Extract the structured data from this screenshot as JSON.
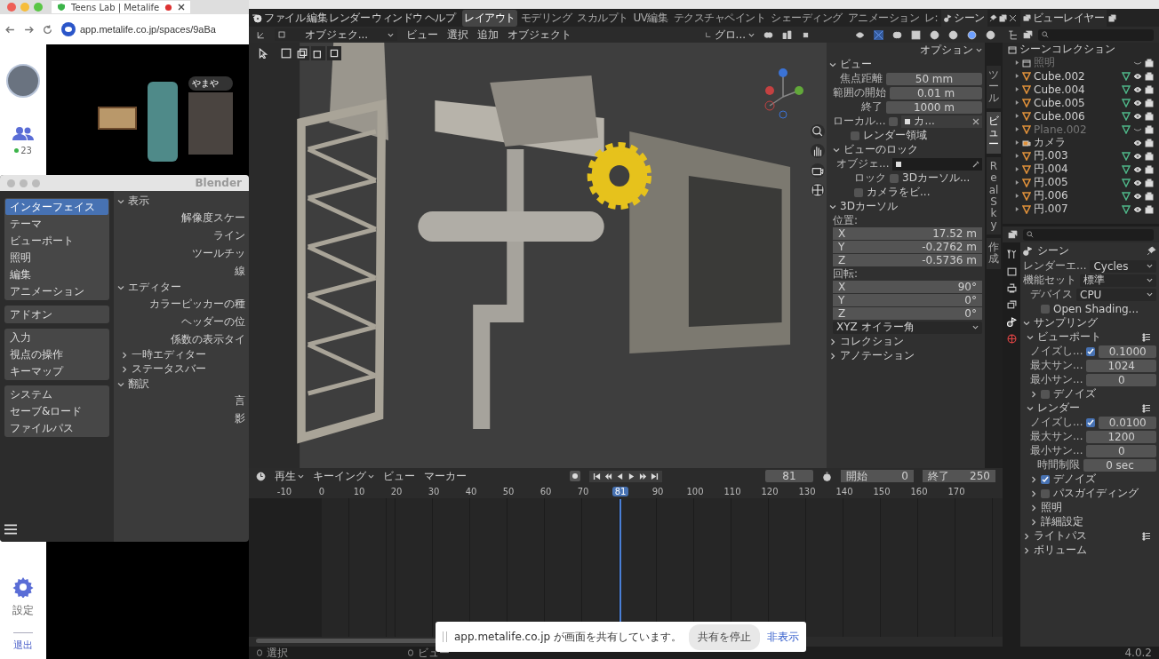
{
  "browser": {
    "tabs": [
      {
        "title": "Teens Lab | Metalife",
        "selected": true
      }
    ],
    "url": "app.metalife.co.jp/spaces/9aBa"
  },
  "metalife": {
    "online_count": "23",
    "settings_label": "設定",
    "exit_label": "退出",
    "video_name": "やまや"
  },
  "preferences": {
    "title": "Blender",
    "nav_groups": [
      [
        {
          "label": "インターフェイス",
          "selected": true
        },
        {
          "label": "テーマ",
          "selected": false
        },
        {
          "label": "ビューポート",
          "selected": false
        },
        {
          "label": "照明",
          "selected": false
        },
        {
          "label": "編集",
          "selected": false
        },
        {
          "label": "アニメーション",
          "selected": false
        }
      ],
      [
        {
          "label": "アドオン",
          "selected": false
        }
      ],
      [
        {
          "label": "入力",
          "selected": false
        },
        {
          "label": "視点の操作",
          "selected": false
        },
        {
          "label": "キーマップ",
          "selected": false
        }
      ],
      [
        {
          "label": "システム",
          "selected": false
        },
        {
          "label": "セーブ&ロード",
          "selected": false
        },
        {
          "label": "ファイルパス",
          "selected": false
        }
      ]
    ],
    "sections": [
      {
        "kind": "panel",
        "label": "表示",
        "expanded": true,
        "children": [
          {
            "kind": "label",
            "label": "解像度スケー"
          },
          {
            "kind": "label",
            "label": "ライン"
          },
          {
            "kind": "label",
            "label": "ツールチッ"
          },
          {
            "kind": "label",
            "label": "線"
          }
        ]
      },
      {
        "kind": "panel",
        "label": "エディター",
        "expanded": true,
        "children": [
          {
            "kind": "label",
            "label": "カラーピッカーの種"
          },
          {
            "kind": "label",
            "label": "ヘッダーの位"
          },
          {
            "kind": "label",
            "label": "係数の表示タイ"
          },
          {
            "kind": "panel",
            "label": "一時エディター",
            "expanded": false
          },
          {
            "kind": "panel",
            "label": "ステータスバー",
            "expanded": false
          }
        ]
      },
      {
        "kind": "panel",
        "label": "翻訳",
        "expanded": true,
        "children": [
          {
            "kind": "label",
            "label": "言"
          },
          {
            "kind": "label",
            "label": "影"
          }
        ]
      }
    ]
  },
  "blender": {
    "menus": [
      "ファイル",
      "編集",
      "レンダー",
      "ウィンドウ",
      "ヘルプ"
    ],
    "workspaces": [
      {
        "label": "レイアウト",
        "selected": true
      },
      {
        "label": "モデリング",
        "selected": false
      },
      {
        "label": "スカルプト",
        "selected": false
      },
      {
        "label": "UV編集",
        "selected": false
      },
      {
        "label": "テクスチャペイント",
        "selected": false
      },
      {
        "label": "シェーディング",
        "selected": false
      },
      {
        "label": "アニメーション",
        "selected": false
      },
      {
        "label": "レ:",
        "selected": false
      }
    ],
    "scene": "シーン",
    "view_layer": "ビューレイヤー",
    "viewport": {
      "mode": "オブジェク...",
      "menus": [
        "ビュー",
        "選択",
        "追加",
        "オブジェクト"
      ],
      "orientation": "グロ...",
      "options": "オプション",
      "sidebar_tabs": [
        {
          "label": "ツール",
          "selected": false
        },
        {
          "label": "ビュー",
          "selected": true
        },
        {
          "label": "Real Sky",
          "selected": false
        },
        {
          "label": "作成",
          "selected": false
        }
      ],
      "sidebar": [
        {
          "kind": "panel",
          "label": "ビュー",
          "expanded": true,
          "children": [
            {
              "kind": "number",
              "label": "焦点距離",
              "value": "50 mm"
            },
            {
              "kind": "number",
              "label": "範囲の開始",
              "value": "0.01 m"
            },
            {
              "kind": "number",
              "label": "終了",
              "value": "1000 m"
            },
            {
              "kind": "local",
              "label": "ローカル...",
              "checked": false,
              "value": "カ..."
            },
            {
              "kind": "checkbox",
              "label": "レンダー領域",
              "checked": false
            },
            {
              "kind": "panel",
              "label": "ビューのロック",
              "expanded": true,
              "children": [
                {
                  "kind": "object-field",
                  "label": "オブジェ..."
                },
                {
                  "kind": "checkbox",
                  "row_label": "ロック",
                  "label": "3Dカーソル...",
                  "checked": false
                },
                {
                  "kind": "checkbox",
                  "label": "カメラをビ...",
                  "checked": false
                }
              ]
            }
          ]
        },
        {
          "kind": "panel",
          "label": "3Dカーソル",
          "expanded": true,
          "children": [
            {
              "kind": "heading",
              "label": "位置:"
            },
            {
              "kind": "vector",
              "items": [
                {
                  "axis": "X",
                  "value": "17.52 m"
                },
                {
                  "axis": "Y",
                  "value": "-0.2762 m"
                },
                {
                  "axis": "Z",
                  "value": "-0.5736 m"
                }
              ]
            },
            {
              "kind": "heading",
              "label": "回転:"
            },
            {
              "kind": "vector",
              "items": [
                {
                  "axis": "X",
                  "value": "90°"
                },
                {
                  "axis": "Y",
                  "value": "0°"
                },
                {
                  "axis": "Z",
                  "value": "0°"
                }
              ]
            },
            {
              "kind": "dropdown",
              "value": "XYZ オイラー角"
            }
          ]
        },
        {
          "kind": "panel",
          "label": "コレクション",
          "expanded": false
        },
        {
          "kind": "panel",
          "label": "アノテーション",
          "expanded": false
        }
      ]
    },
    "timeline": {
      "menus": [
        {
          "label": "再生",
          "dropdown": true
        },
        {
          "label": "キーイング",
          "dropdown": true
        },
        {
          "label": "ビュー",
          "dropdown": false
        },
        {
          "label": "マーカー",
          "dropdown": false
        }
      ],
      "current_frame": "81",
      "start_label": "開始",
      "start": "0",
      "end_label": "終了",
      "end": "250",
      "ruler_before": [
        "-10",
        "0",
        "10",
        "20",
        "30",
        "40",
        "50",
        "60",
        "70"
      ],
      "playhead": "81",
      "ruler_after": [
        "90",
        "100",
        "110",
        "120",
        "130",
        "140",
        "150",
        "160",
        "170"
      ]
    },
    "outliner": {
      "title": "シーンコレクション",
      "rows": [
        {
          "name": "照明",
          "kind": "collection",
          "visible": false
        },
        {
          "name": "Cube.002",
          "kind": "mesh",
          "visible": true
        },
        {
          "name": "Cube.004",
          "kind": "mesh",
          "visible": true
        },
        {
          "name": "Cube.005",
          "kind": "mesh",
          "visible": true
        },
        {
          "name": "Cube.006",
          "kind": "mesh",
          "visible": true
        },
        {
          "name": "Plane.002",
          "kind": "mesh",
          "visible": false
        },
        {
          "name": "カメラ",
          "kind": "camera",
          "visible": true
        },
        {
          "name": "円.003",
          "kind": "mesh",
          "visible": true
        },
        {
          "name": "円.004",
          "kind": "mesh",
          "visible": true
        },
        {
          "name": "円.005",
          "kind": "mesh",
          "visible": true
        },
        {
          "name": "円.006",
          "kind": "mesh",
          "visible": true
        },
        {
          "name": "円.007",
          "kind": "mesh",
          "visible": true
        }
      ]
    },
    "properties": {
      "title": "シーン",
      "items": [
        {
          "kind": "dropdown",
          "label": "レンダーエ...",
          "value": "Cycles"
        },
        {
          "kind": "dropdown",
          "label": "機能セット",
          "value": "標準"
        },
        {
          "kind": "dropdown",
          "label": "デバイス",
          "value": "CPU"
        },
        {
          "kind": "checkbox",
          "label": "Open Shading...",
          "checked": false
        },
        {
          "kind": "panel",
          "label": "サンプリング",
          "expanded": true,
          "children": [
            {
              "kind": "panel",
              "label": "ビューポート",
              "expanded": true,
              "presets": true,
              "children": [
                {
                  "kind": "toggle-number",
                  "label": "ノイズし...",
                  "checked": true,
                  "value": "0.1000"
                },
                {
                  "kind": "number",
                  "label": "最大サン...",
                  "value": "1024"
                },
                {
                  "kind": "number",
                  "label": "最小サン...",
                  "value": "0"
                },
                {
                  "kind": "panel",
                  "label": "デノイズ",
                  "expanded": false,
                  "checked": false
                }
              ]
            },
            {
              "kind": "panel",
              "label": "レンダー",
              "expanded": true,
              "presets": true,
              "children": [
                {
                  "kind": "toggle-number",
                  "label": "ノイズし...",
                  "checked": true,
                  "value": "0.0100"
                },
                {
                  "kind": "number",
                  "label": "最大サン...",
                  "value": "1200"
                },
                {
                  "kind": "number",
                  "label": "最小サン...",
                  "value": "0"
                },
                {
                  "kind": "number",
                  "label": "時間制限",
                  "value": "0 sec"
                },
                {
                  "kind": "panel",
                  "label": "デノイズ",
                  "expanded": false,
                  "checked": true
                },
                {
                  "kind": "panel",
                  "label": "パスガイディング",
                  "expanded": false,
                  "checked": false
                },
                {
                  "kind": "panel",
                  "label": "照明",
                  "expanded": false
                },
                {
                  "kind": "panel",
                  "label": "詳細設定",
                  "expanded": false
                }
              ]
            }
          ]
        },
        {
          "kind": "panel",
          "label": "ライトパス",
          "expanded": false,
          "presets": true
        },
        {
          "kind": "panel",
          "label": "ボリューム",
          "expanded": false
        }
      ]
    },
    "status_bar": {
      "items": [
        "選択",
        "ビュー"
      ],
      "version": "4.0.2"
    }
  },
  "toast": {
    "message": "app.metalife.co.jp が画面を共有しています。",
    "stop_button": "共有を停止",
    "hide_link": "非表示"
  }
}
